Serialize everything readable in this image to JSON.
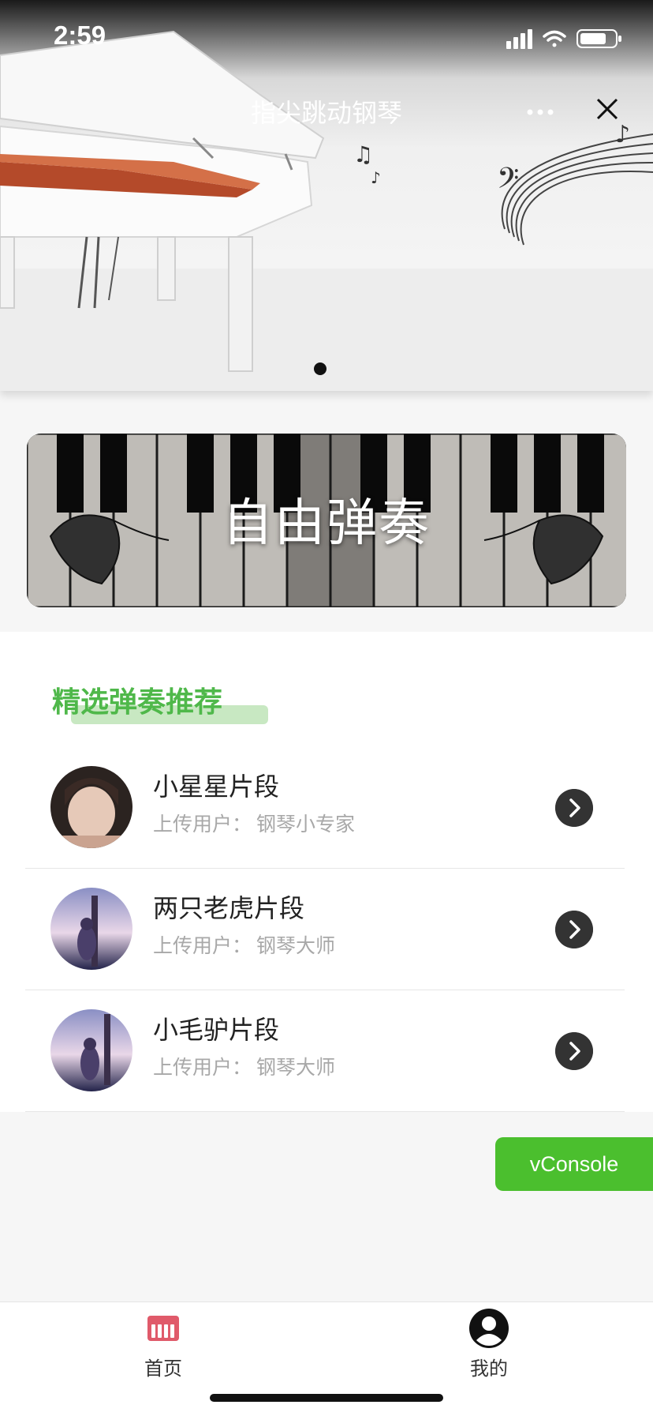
{
  "status_bar": {
    "time": "2:59"
  },
  "header": {
    "title": "指尖跳动钢琴",
    "more_icon": "more-dots-icon",
    "close_icon": "close-icon"
  },
  "carousel": {
    "page_count": 1,
    "active_index": 0
  },
  "free_play": {
    "label": "自由弹奏"
  },
  "section": {
    "title": "精选弹奏推荐",
    "accent": "#4fb84a"
  },
  "list": [
    {
      "title": "小星星片段",
      "uploader_label": "上传用户：",
      "uploader": "钢琴小专家"
    },
    {
      "title": "两只老虎片段",
      "uploader_label": "上传用户：",
      "uploader": "钢琴大师"
    },
    {
      "title": "小毛驴片段",
      "uploader_label": "上传用户：",
      "uploader": "钢琴大师"
    }
  ],
  "vconsole": {
    "label": "vConsole",
    "color": "#4bbf2e"
  },
  "tabbar": {
    "tabs": [
      {
        "label": "首页",
        "icon": "piano-keys-icon",
        "color": "#e05a6a"
      },
      {
        "label": "我的",
        "icon": "user-avatar-icon"
      }
    ]
  }
}
